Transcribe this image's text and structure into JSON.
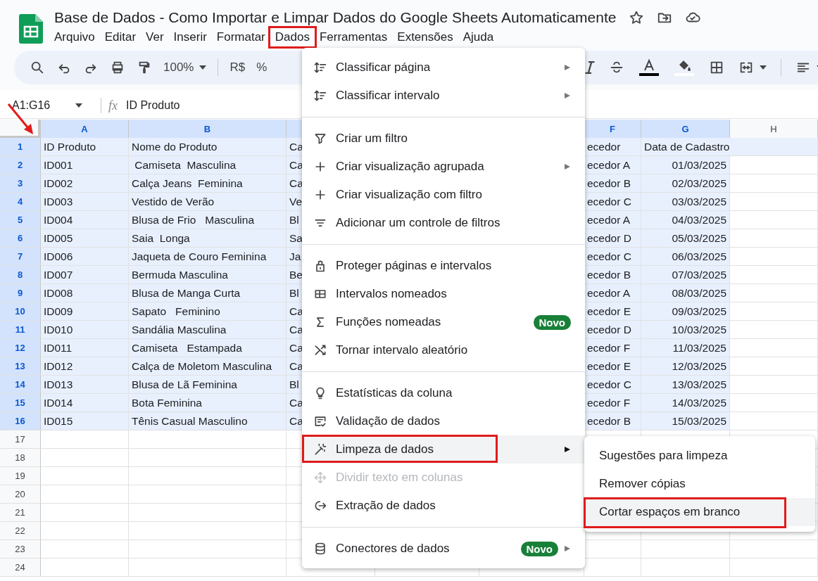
{
  "document": {
    "title": "Base de Dados - Como Importar e Limpar Dados do Google Sheets Automaticamente",
    "menus": [
      {
        "label": "Arquivo",
        "highlighted": false
      },
      {
        "label": "Editar",
        "highlighted": false
      },
      {
        "label": "Ver",
        "highlighted": false
      },
      {
        "label": "Inserir",
        "highlighted": false
      },
      {
        "label": "Formatar",
        "highlighted": false
      },
      {
        "label": "Dados",
        "highlighted": true
      },
      {
        "label": "Ferramentas",
        "highlighted": false
      },
      {
        "label": "Extensões",
        "highlighted": false
      },
      {
        "label": "Ajuda",
        "highlighted": false
      }
    ]
  },
  "toolbar": {
    "zoom": "100%",
    "currency": "R$",
    "percent": "%"
  },
  "formula_bar": {
    "name_box": "A1:G16",
    "fx": "fx",
    "value": "ID Produto"
  },
  "sheet": {
    "columns": [
      {
        "letter": "A",
        "selected": true
      },
      {
        "letter": "B",
        "selected": true
      },
      {
        "selected": true
      },
      {
        "letter": "F",
        "selected": true
      },
      {
        "letter": "G",
        "selected": true
      },
      {
        "letter": "H",
        "selected": false
      }
    ],
    "rows": [
      {
        "number": "1",
        "selected": true,
        "cells": [
          "ID Produto",
          "Nome do Produto",
          "Ca",
          "ecedor",
          "Data de Cadastro"
        ]
      },
      {
        "number": "2",
        "selected": true,
        "cells": [
          "ID001",
          " Camiseta  Masculina",
          "Ca",
          "ecedor A",
          "01/03/2025"
        ]
      },
      {
        "number": "3",
        "selected": true,
        "cells": [
          "ID002",
          "Calça Jeans  Feminina",
          "Ca",
          "ecedor B",
          "02/03/2025"
        ]
      },
      {
        "number": "4",
        "selected": true,
        "cells": [
          "ID003",
          "Vestido de Verão",
          "Ve",
          "ecedor C",
          "03/03/2025"
        ]
      },
      {
        "number": "5",
        "selected": true,
        "cells": [
          "ID004",
          "Blusa de Frio   Masculina",
          "Bl",
          "ecedor A",
          "04/03/2025"
        ]
      },
      {
        "number": "6",
        "selected": true,
        "cells": [
          "ID005",
          "Saia  Longa",
          "Sa",
          "ecedor D",
          "05/03/2025"
        ]
      },
      {
        "number": "7",
        "selected": true,
        "cells": [
          "ID006",
          "Jaqueta de Couro Feminina",
          "Ja",
          "ecedor C",
          "06/03/2025"
        ]
      },
      {
        "number": "8",
        "selected": true,
        "cells": [
          "ID007",
          "Bermuda Masculina",
          "Be",
          "ecedor B",
          "07/03/2025"
        ]
      },
      {
        "number": "9",
        "selected": true,
        "cells": [
          "ID008",
          "Blusa de Manga Curta",
          "Bl",
          "ecedor A",
          "08/03/2025"
        ]
      },
      {
        "number": "10",
        "selected": true,
        "cells": [
          "ID009",
          "Sapato   Feminino",
          "Ca",
          "ecedor E",
          "09/03/2025"
        ]
      },
      {
        "number": "11",
        "selected": true,
        "cells": [
          "ID010",
          "Sandália Masculina",
          "Ca",
          "ecedor D",
          "10/03/2025"
        ]
      },
      {
        "number": "12",
        "selected": true,
        "cells": [
          "ID011",
          "Camiseta   Estampada",
          "Ca",
          "ecedor F",
          "11/03/2025"
        ]
      },
      {
        "number": "13",
        "selected": true,
        "cells": [
          "ID012",
          "Calça de Moletom Masculina",
          "Ca",
          "ecedor E",
          "12/03/2025"
        ]
      },
      {
        "number": "14",
        "selected": true,
        "cells": [
          "ID013",
          "Blusa de Lã Feminina",
          "Bl",
          "ecedor C",
          "13/03/2025"
        ]
      },
      {
        "number": "15",
        "selected": true,
        "cells": [
          "ID014",
          "Bota Feminina",
          "Ca",
          "ecedor F",
          "14/03/2025"
        ]
      },
      {
        "number": "16",
        "selected": true,
        "cells": [
          "ID015",
          "Tênis Casual Masculino",
          "Ca",
          "ecedor B",
          "15/03/2025"
        ]
      },
      {
        "number": "17",
        "selected": false
      },
      {
        "number": "18",
        "selected": false
      },
      {
        "number": "19",
        "selected": false
      },
      {
        "number": "20",
        "selected": false
      },
      {
        "number": "21",
        "selected": false
      },
      {
        "number": "22",
        "selected": false
      },
      {
        "number": "23",
        "selected": false
      },
      {
        "number": "24",
        "selected": false
      }
    ]
  },
  "menu": {
    "groups": [
      [
        {
          "label": "Classificar página",
          "submenu": true
        },
        {
          "label": "Classificar intervalo",
          "submenu": true
        }
      ],
      [
        {
          "label": "Criar um filtro"
        },
        {
          "label": "Criar visualização agrupada",
          "submenu": true
        },
        {
          "label": "Criar visualização com filtro"
        },
        {
          "label": "Adicionar um controle de filtros"
        }
      ],
      [
        {
          "label": "Proteger páginas e intervalos"
        },
        {
          "label": "Intervalos nomeados"
        },
        {
          "label": "Funções nomeadas",
          "badge": "Novo"
        },
        {
          "label": "Tornar intervalo aleatório"
        }
      ],
      [
        {
          "label": "Estatísticas da coluna"
        },
        {
          "label": "Validação de dados"
        },
        {
          "label": "Limpeza de dados",
          "submenu": true,
          "selected": true,
          "highlighted": true
        },
        {
          "label": "Dividir texto em colunas",
          "disabled": true
        },
        {
          "label": "Extração de dados"
        }
      ],
      [
        {
          "label": "Conectores de dados",
          "badge": "Novo",
          "submenu": true
        }
      ]
    ]
  },
  "submenu": {
    "items": [
      {
        "label": "Sugestões para limpeza",
        "selected": false,
        "highlighted": false
      },
      {
        "label": "Remover cópias",
        "selected": false,
        "highlighted": false
      },
      {
        "label": "Cortar espaços em branco",
        "selected": true,
        "highlighted": true
      }
    ]
  },
  "annotation_arrow": true
}
